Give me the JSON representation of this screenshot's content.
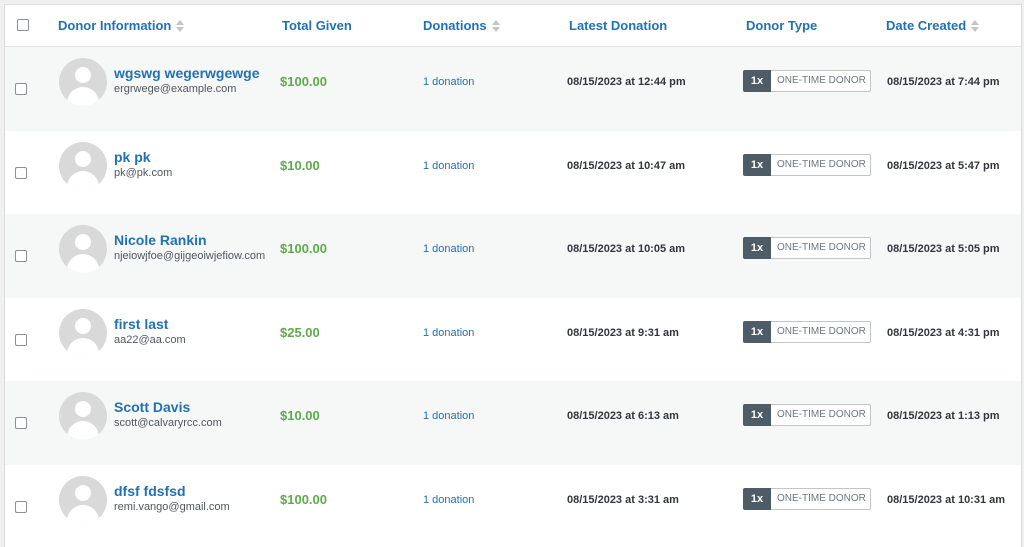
{
  "table": {
    "columns": {
      "donor_information": "Donor Information",
      "total_given": "Total Given",
      "donations": "Donations",
      "latest_donation": "Latest Donation",
      "donor_type": "Donor Type",
      "date_created": "Date Created"
    },
    "rows": [
      {
        "name": "wgswg wegerwgewge",
        "email": "ergrwege@example.com",
        "total": "$100.00",
        "donations": "1 donation",
        "latest": "08/15/2023 at 12:44 pm",
        "freq": "1x",
        "type": "ONE-TIME DONOR",
        "created": "08/15/2023 at 7:44 pm"
      },
      {
        "name": "pk pk",
        "email": "pk@pk.com",
        "total": "$10.00",
        "donations": "1 donation",
        "latest": "08/15/2023 at 10:47 am",
        "freq": "1x",
        "type": "ONE-TIME DONOR",
        "created": "08/15/2023 at 5:47 pm"
      },
      {
        "name": "Nicole Rankin",
        "email": "njeiowjfoe@gijgeoiwjefiow.com",
        "total": "$100.00",
        "donations": "1 donation",
        "latest": "08/15/2023 at 10:05 am",
        "freq": "1x",
        "type": "ONE-TIME DONOR",
        "created": "08/15/2023 at 5:05 pm"
      },
      {
        "name": "first last",
        "email": "aa22@aa.com",
        "total": "$25.00",
        "donations": "1 donation",
        "latest": "08/15/2023 at 9:31 am",
        "freq": "1x",
        "type": "ONE-TIME DONOR",
        "created": "08/15/2023 at 4:31 pm"
      },
      {
        "name": "Scott Davis",
        "email": "scott@calvaryrcc.com",
        "total": "$10.00",
        "donations": "1 donation",
        "latest": "08/15/2023 at 6:13 am",
        "freq": "1x",
        "type": "ONE-TIME DONOR",
        "created": "08/15/2023 at 1:13 pm"
      },
      {
        "name": "dfsf fdsfsd",
        "email": "remi.vango@gmail.com",
        "total": "$100.00",
        "donations": "1 donation",
        "latest": "08/15/2023 at 3:31 am",
        "freq": "1x",
        "type": "ONE-TIME DONOR",
        "created": "08/15/2023 at 10:31 am"
      }
    ]
  },
  "colors": {
    "link": "#2271b1",
    "amount": "#5eaa4c",
    "badge": "#4e5c68"
  },
  "icons": {
    "sort": "sort-arrows-icon",
    "avatar": "default-user-avatar"
  }
}
